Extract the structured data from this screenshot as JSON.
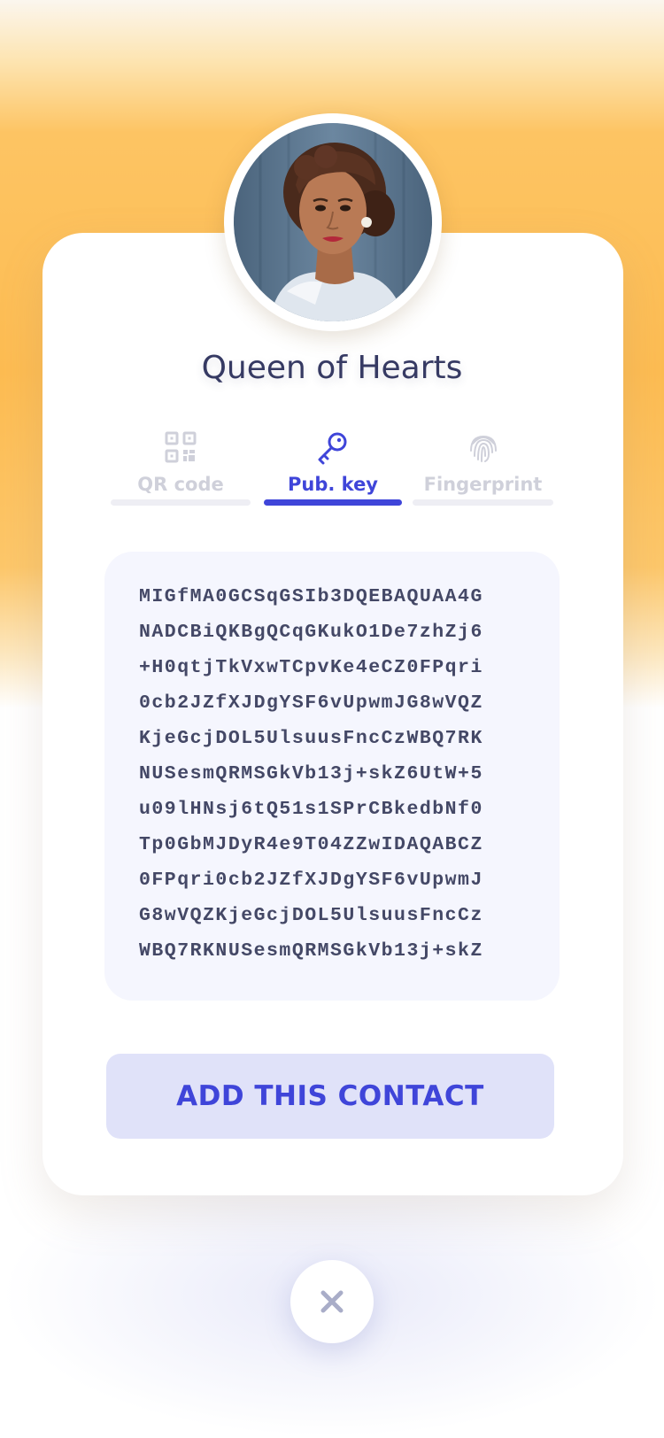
{
  "contact": {
    "name": "Queen of Hearts",
    "avatar_icon": "portrait-photo"
  },
  "tabs": [
    {
      "label": "QR code",
      "icon": "qr-code-icon",
      "active": false
    },
    {
      "label": "Pub. key",
      "icon": "key-icon",
      "active": true
    },
    {
      "label": "Fingerprint",
      "icon": "fingerprint-icon",
      "active": false
    }
  ],
  "public_key": {
    "lines": [
      "MIGfMA0GCSqGSIb3DQEBAQUAA4G",
      "NADCBiQKBgQCqGKukO1De7zhZj6",
      "+H0qtjTkVxwTCpvKe4eCZ0FPqri",
      "0cb2JZfXJDgYSF6vUpwmJG8wVQZ",
      "KjeGcjDOL5UlsuusFncCzWBQ7RK",
      "NUSesmQRMSGkVb13j+skZ6UtW+5",
      "u09lHNsj6tQ51s1SPrCBkedbNf0",
      "Tp0GbMJDyR4e9T04ZZwIDAQABCZ",
      "0FPqri0cb2JZfXJDgYSF6vUpwmJ",
      "G8wVQZKjeGcjDOL5UlsuusFncCz",
      "WBQ7RKNUSesmQRMSGkVb13j+skZ"
    ]
  },
  "actions": {
    "add_label": "ADD THIS CONTACT",
    "close_icon": "close-icon"
  },
  "colors": {
    "accent": "#3f45d9",
    "accent_light": "#e0e2f9",
    "text_dark": "#363a63",
    "inactive": "#cfd0da",
    "background_orange": "#fdbc52"
  }
}
